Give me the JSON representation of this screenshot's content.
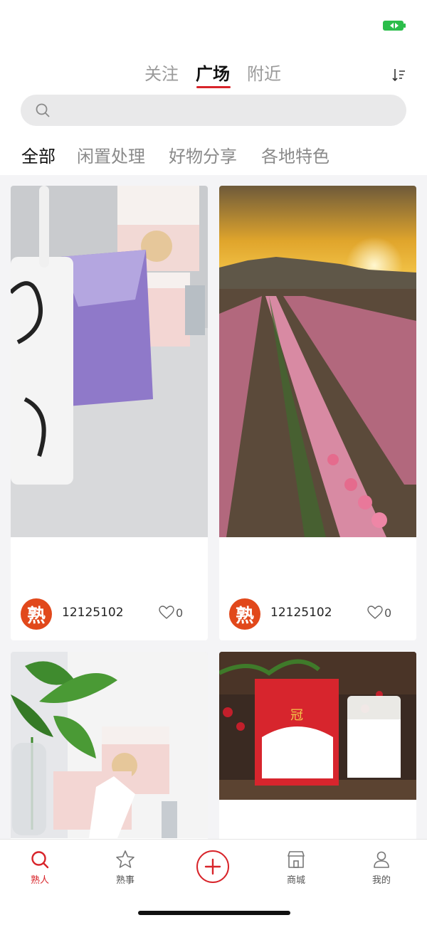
{
  "status_bar": {
    "battery_icon": "battery-icon",
    "battery_color": "#2bbd4a"
  },
  "top_tabs": [
    {
      "label": "关注"
    },
    {
      "label": "广场",
      "active": true
    },
    {
      "label": "附近"
    }
  ],
  "sort_icon": "sort-icon",
  "search": {
    "icon": "search-icon",
    "placeholder": ""
  },
  "categories": [
    {
      "label": "全部",
      "active": true
    },
    {
      "label": "闲置处理"
    },
    {
      "label": "好物分享"
    },
    {
      "label": "各地特色"
    }
  ],
  "posts": [
    {
      "image": "photo of a mug, tissue pack and tea boxes on a desk",
      "avatar_text": "熟",
      "username": "12125102",
      "likes": "0"
    },
    {
      "image": "tulip field at sunset",
      "avatar_text": "熟",
      "username": "12125102",
      "likes": "0"
    },
    {
      "image": "potted plant and tea boxes on a desk",
      "avatar_text": "",
      "username": "",
      "likes": ""
    },
    {
      "image": "milk powder box with strawberries and a glass of milk",
      "avatar_text": "",
      "username": "",
      "likes": ""
    }
  ],
  "tab_bar": {
    "items": [
      {
        "label": "熟人",
        "icon": "search-icon",
        "active": true
      },
      {
        "label": "熟事",
        "icon": "star-icon"
      },
      {
        "label": "",
        "icon": "plus-icon"
      },
      {
        "label": "商城",
        "icon": "shop-icon"
      },
      {
        "label": "我的",
        "icon": "user-icon"
      }
    ]
  },
  "colors": {
    "accent": "#d8242a",
    "avatar": "#e1481b",
    "feed_background": "#f4f4f6"
  }
}
